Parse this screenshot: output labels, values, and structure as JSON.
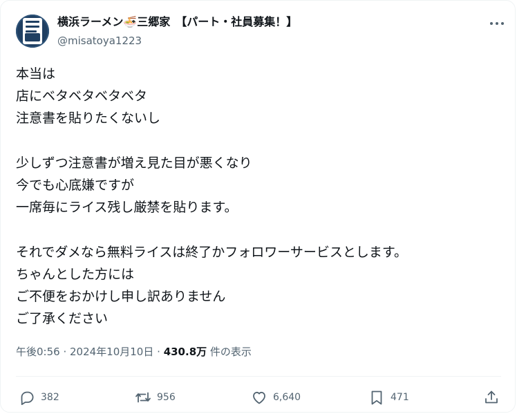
{
  "user": {
    "display_name": "横浜ラーメン🍜三郷家　【パート・社員募集！】",
    "handle": "@misatoya1223"
  },
  "post": {
    "text": "本当は\n店にベタベタベタベタ\n注意書を貼りたくないし\n\n少しずつ注意書が増え見た目が悪くなり\n今でも心底嫌ですが\n一席毎にライス残し厳禁を貼ります。\n\nそれでダメなら無料ライスは終了かフォロワーサービスとします。\nちゃんとした方には\nご不便をおかけし申し訳ありません\nご了承ください",
    "timestamp": "午後0:56 · 2024年10月10日",
    "separator": "·",
    "views_count": "430.8万",
    "views_label": "件の表示"
  },
  "actions": {
    "reply_count": "382",
    "repost_count": "956",
    "like_count": "6,640",
    "bookmark_count": "471"
  },
  "icons": {
    "more": "more-icon",
    "reply": "reply-icon",
    "repost": "repost-icon",
    "like": "like-icon",
    "bookmark": "bookmark-icon",
    "share": "share-icon"
  },
  "colors": {
    "text": "#0f1419",
    "secondary": "#536471",
    "border": "#eff3f4",
    "avatar_bg": "#1f3f62"
  }
}
